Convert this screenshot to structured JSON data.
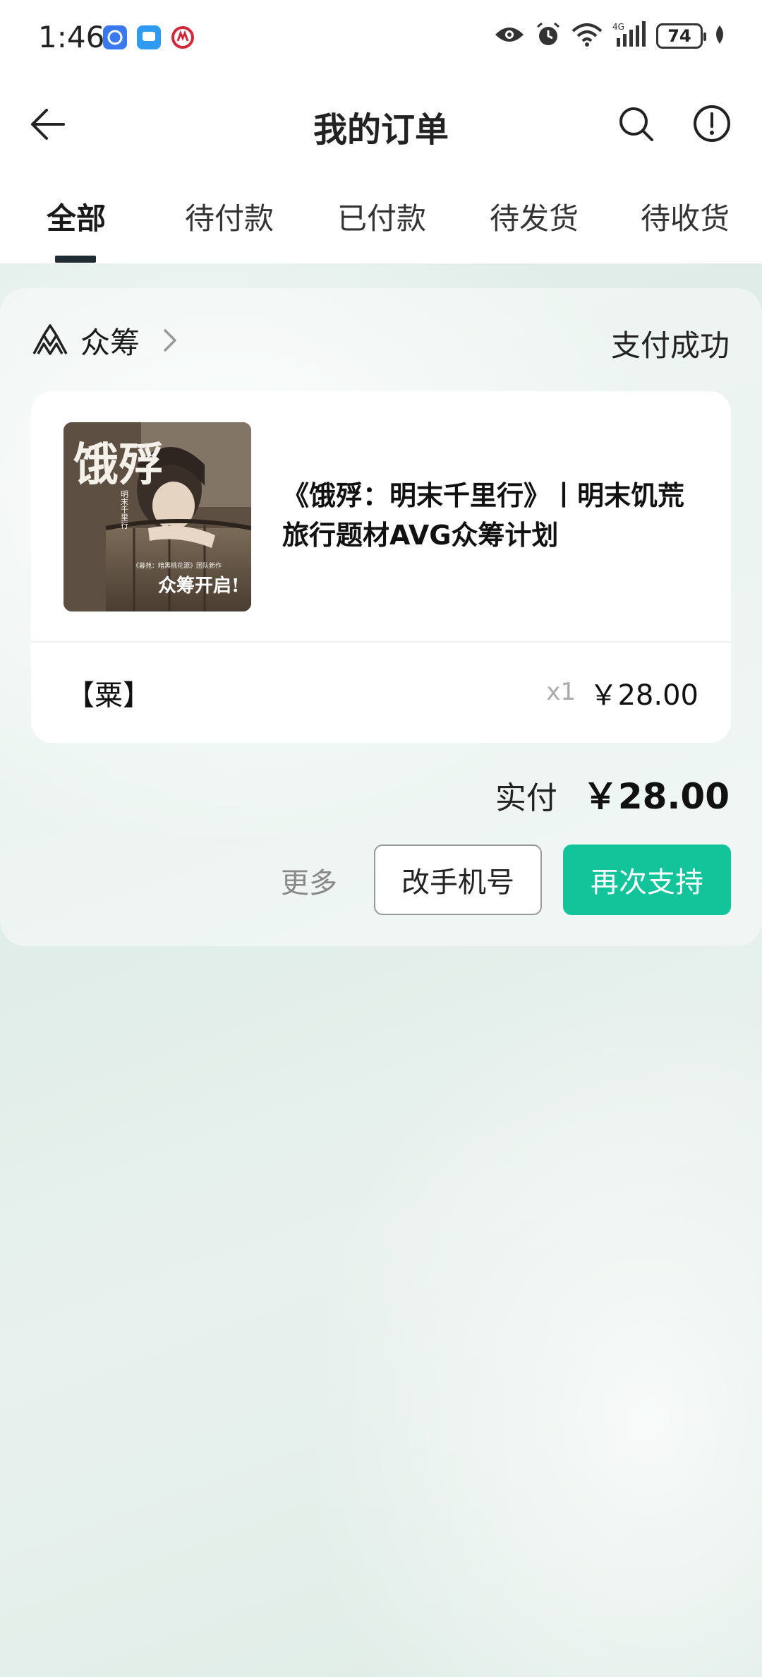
{
  "status_bar": {
    "time": "1:46",
    "battery": "74",
    "network": "4G",
    "icons": [
      "eye-icon",
      "alarm-icon",
      "wifi-icon",
      "signal-icon",
      "battery-icon",
      "leaf-icon"
    ],
    "app_icons": [
      "blue-app-icon",
      "message-app-icon",
      "metro-app-icon"
    ]
  },
  "header": {
    "title": "我的订单",
    "back_icon": "back-arrow-icon",
    "search_icon": "search-icon",
    "info_icon": "info-icon"
  },
  "tabs": [
    {
      "label": "全部",
      "active": true
    },
    {
      "label": "待付款",
      "active": false
    },
    {
      "label": "已付款",
      "active": false
    },
    {
      "label": "待发货",
      "active": false
    },
    {
      "label": "待收货",
      "active": false
    }
  ],
  "order": {
    "shop_name": "众筹",
    "status": "支付成功",
    "item": {
      "title": "《饿殍：明末千里行》丨明末饥荒旅行题材AVG众筹计划",
      "cover_text": {
        "main": "饿殍",
        "sub": "明末千里行",
        "credit": "《暮苑：暗黑桃花源》团队新作",
        "banner": "众筹开启!"
      },
      "sku": "【粟】",
      "qty": "x1",
      "price": "￥28.00"
    },
    "paid_label": "实付",
    "paid_amount": "￥28.00",
    "actions": {
      "more": "更多",
      "change_phone": "改手机号",
      "support_again": "再次支持"
    }
  },
  "colors": {
    "accent": "#13c49a",
    "background": "#e3eeea",
    "tab_indicator": "#1f2a33"
  }
}
